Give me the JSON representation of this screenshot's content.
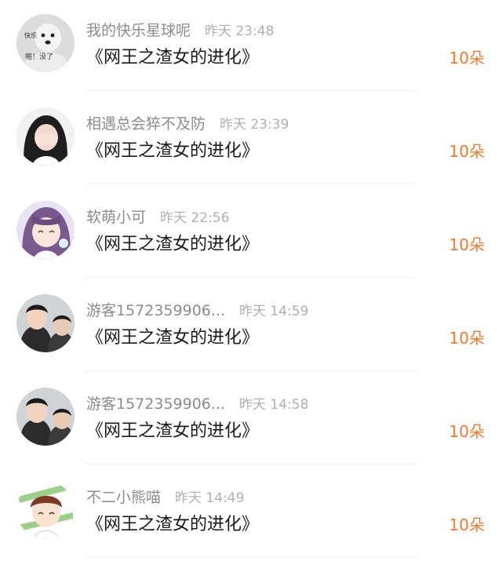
{
  "gift_records": [
    {
      "user": "我的快乐星球呢",
      "time": "昨天 23:48",
      "content": "《网王之渣女的进化》",
      "gift": "10朵",
      "avatar_texts": [
        "快乐",
        "啪！没了"
      ]
    },
    {
      "user": "相遇总会猝不及防",
      "time": "昨天 23:39",
      "content": "《网王之渣女的进化》",
      "gift": "10朵"
    },
    {
      "user": "软萌小可",
      "time": "昨天 22:56",
      "content": "《网王之渣女的进化》",
      "gift": "10朵"
    },
    {
      "user": "游客1572359906...",
      "time": "昨天 14:59",
      "content": "《网王之渣女的进化》",
      "gift": "10朵"
    },
    {
      "user": "游客1572359906...",
      "time": "昨天 14:58",
      "content": "《网王之渣女的进化》",
      "gift": "10朵"
    },
    {
      "user": "不二小熊喵",
      "time": "昨天 14:49",
      "content": "《网王之渣女的进化》",
      "gift": "10朵"
    }
  ],
  "colors": {
    "accent": "#f07a2c",
    "username": "#8c8c8c",
    "timestamp": "#b0b0b0",
    "content": "#1a1a1a"
  }
}
